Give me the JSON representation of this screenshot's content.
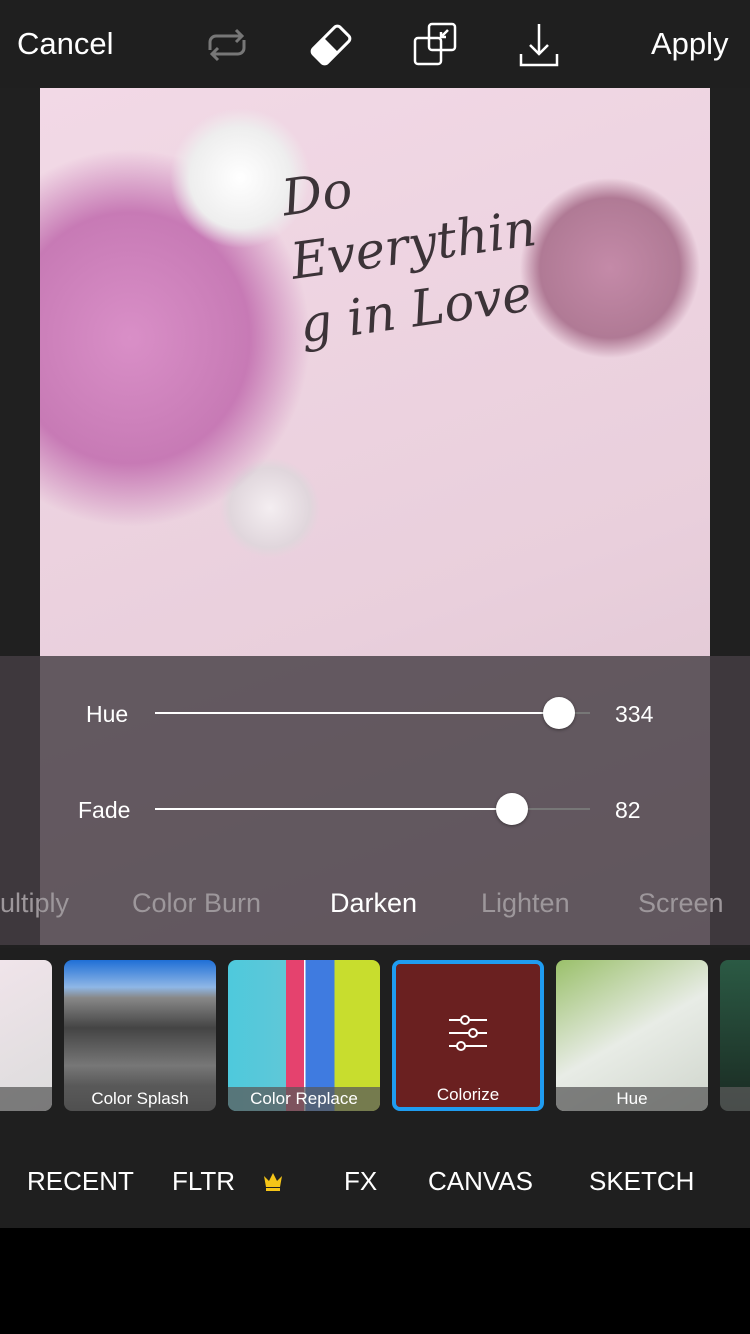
{
  "header": {
    "cancel": "Cancel",
    "apply": "Apply",
    "icons": [
      "repeat-icon",
      "eraser-icon",
      "compare-icon",
      "download-icon"
    ]
  },
  "photo": {
    "script_text": "Do Everything in Love"
  },
  "sliders": [
    {
      "label": "Hue",
      "value": "334",
      "fraction": 0.928
    },
    {
      "label": "Fade",
      "value": "82",
      "fraction": 0.82
    }
  ],
  "blend_modes": [
    {
      "label": "ultiply"
    },
    {
      "label": "Color Burn"
    },
    {
      "label": "Darken",
      "selected": true
    },
    {
      "label": "Lighten"
    },
    {
      "label": "Screen"
    }
  ],
  "effects": [
    {
      "label": ""
    },
    {
      "label": "Color Splash"
    },
    {
      "label": "Color Replace"
    },
    {
      "label": "Colorize",
      "selected": true
    },
    {
      "label": "Hue"
    },
    {
      "label": ""
    }
  ],
  "nav": [
    {
      "label": "RECENT"
    },
    {
      "label": "FLTR",
      "premium": true
    },
    {
      "label": "FX"
    },
    {
      "label": "CANVAS"
    },
    {
      "label": "SKETCH"
    }
  ],
  "colors": {
    "accent": "#1f9cf0",
    "crown": "#f5c518",
    "bar": "#1f1f1f"
  }
}
